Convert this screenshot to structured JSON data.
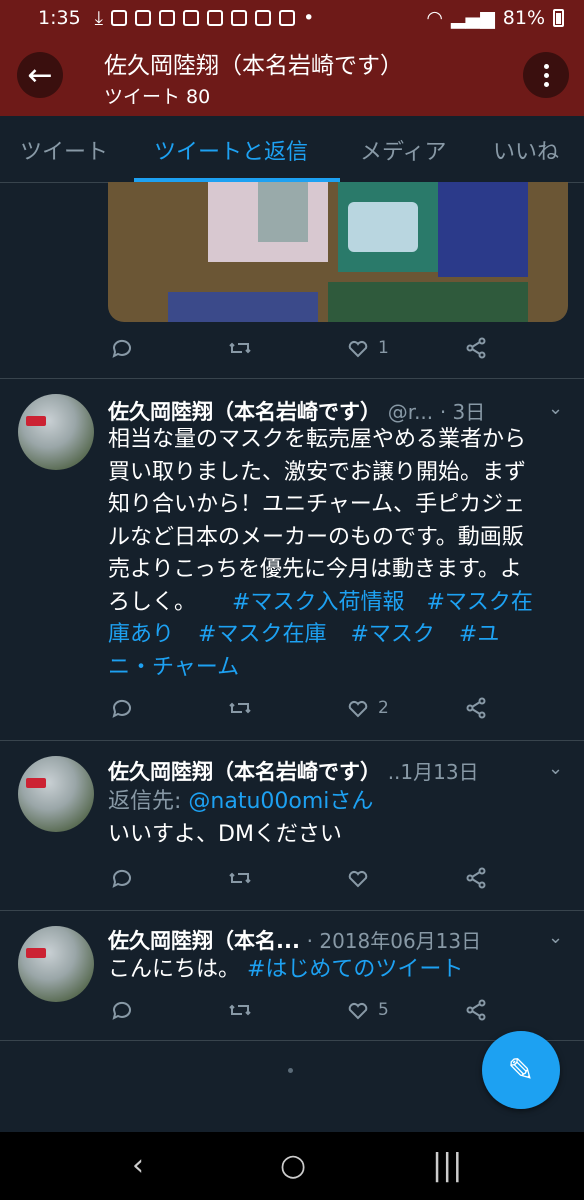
{
  "status_bar": {
    "time": "1:35",
    "battery": "81%"
  },
  "header": {
    "title": "佐久岡陸翔（本名岩崎です）",
    "subtitle": "ツイート 80"
  },
  "tabs": [
    {
      "label": "ツイート"
    },
    {
      "label": "ツイートと返信"
    },
    {
      "label": "メディア"
    },
    {
      "label": "いいね"
    }
  ],
  "tweets": [
    {
      "likes": "1"
    },
    {
      "name": "佐久岡陸翔（本名岩崎です）",
      "handle": "@r...",
      "date": "· 3日",
      "body_lines": [
        "相当な量のマスクを転売屋やめる業者から",
        "買い取りました、激安でお譲り開始。まず",
        "知り合いから！ユニチャーム、手ピカジェ",
        "ルなど日本のメーカーのものです。動画販",
        "売よりこっちを優先に今月は動きます。よ",
        "ろしく。"
      ],
      "hashtags": [
        "#マスク入荷情報",
        "#マスク在",
        "庫あり",
        "#マスク在庫",
        "#マスク",
        "#ユ",
        "ニ・チャーム"
      ],
      "likes": "2"
    },
    {
      "name": "佐久岡陸翔（本名岩崎です）",
      "date": "..1月13日",
      "reply_prefix": "返信先: ",
      "reply_to": "@natu00omiさん",
      "body": "いいすよ、DMください",
      "likes": ""
    },
    {
      "name": "佐久岡陸翔（本名...",
      "date": "· 2018年06月13日",
      "body": "こんにちは。 ",
      "hashtag": "#はじめてのツイート",
      "likes": "5"
    }
  ],
  "colors": {
    "accent": "#1da1f2",
    "header_bg": "#6e1a18",
    "bg": "#15202b"
  }
}
